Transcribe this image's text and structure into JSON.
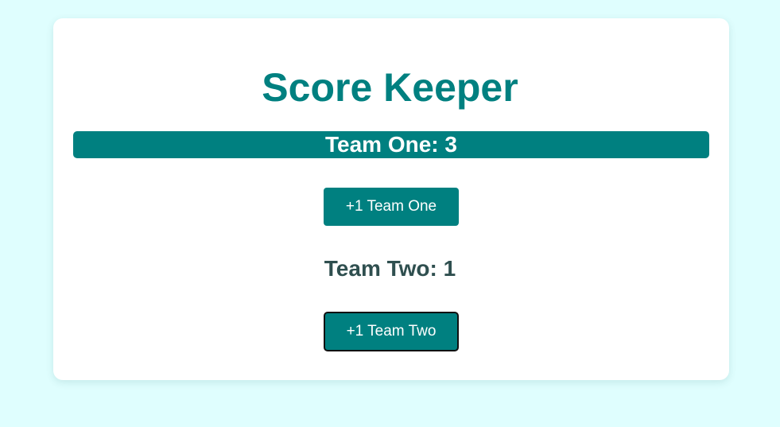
{
  "app": {
    "title": "Score Keeper"
  },
  "teams": [
    {
      "score_text": "Team One: 3",
      "button_label": "+1 Team One"
    },
    {
      "score_text": "Team Two: 1",
      "button_label": "+1 Team Two"
    }
  ],
  "colors": {
    "page_background": "#dffefe",
    "card_background": "#ffffff",
    "accent": "#008080",
    "score_text_dark": "#2f4f4f",
    "button_text": "#ffffff"
  }
}
